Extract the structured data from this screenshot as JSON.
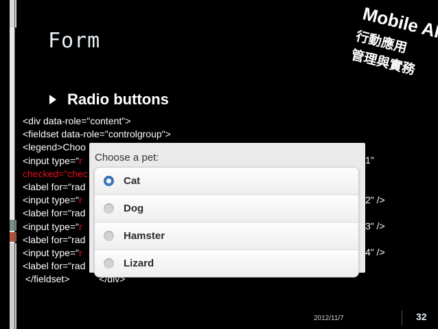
{
  "slide": {
    "title": "Form",
    "bullet": "Radio buttons",
    "date": "2012/11/7",
    "page_number": "32"
  },
  "logo": {
    "text_top": "Mobile APP",
    "text_cn": "行動應用 管理與實務"
  },
  "code_lines": [
    {
      "text": "<div data-role=\"content\">",
      "red": ""
    },
    {
      "text": "<fieldset data-role=\"controlgroup\">",
      "red": ""
    },
    {
      "text": "<legend>Choo",
      "red": ""
    },
    {
      "text": "<input type=\"",
      "red": "r"
    },
    {
      "text": "",
      "red": "checked=\"chec"
    },
    {
      "text": "<label for=\"rad",
      "red": ""
    },
    {
      "text": "<input type=\"",
      "red": "r"
    },
    {
      "text": "<label for=\"rad",
      "red": ""
    },
    {
      "text": "<input type=\"",
      "red": "r"
    },
    {
      "text": "<label for=\"rad",
      "red": ""
    },
    {
      "text": "<input type=\"",
      "red": "r"
    },
    {
      "text": "<label for=\"rad",
      "red": ""
    },
    {
      "text": " </fieldset>",
      "red": "",
      "tail": "           </div>"
    }
  ],
  "code_right": [
    "1\"",
    "2\" />",
    "3\" />",
    "4\" />"
  ],
  "pet_form": {
    "legend": "Choose a pet:",
    "options": [
      {
        "label": "Cat",
        "checked": true
      },
      {
        "label": "Dog",
        "checked": false
      },
      {
        "label": "Hamster",
        "checked": false
      },
      {
        "label": "Lizard",
        "checked": false
      }
    ]
  },
  "colors": {
    "background": "#000000",
    "code_red": "#e4111b",
    "radio_selected": "#3d79c2"
  }
}
